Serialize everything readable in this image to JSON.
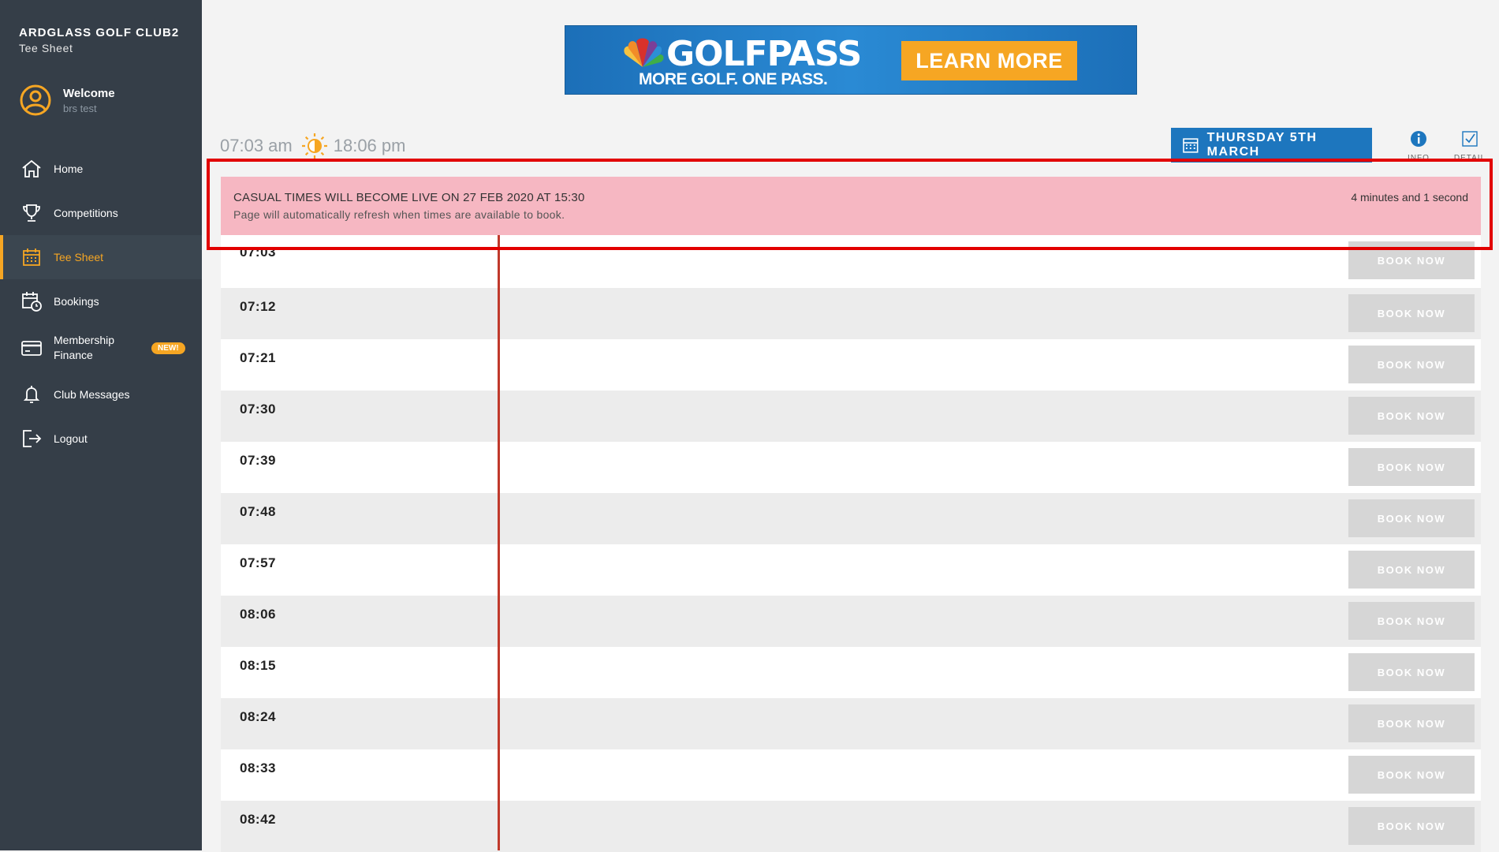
{
  "sidebar": {
    "club_name": "ARDGLASS GOLF CLUB2",
    "subtitle": "Tee Sheet",
    "welcome": "Welcome",
    "user": "brs test",
    "items": [
      {
        "label": "Home",
        "icon": "home-icon",
        "active": false
      },
      {
        "label": "Competitions",
        "icon": "trophy-icon",
        "active": false
      },
      {
        "label": "Tee Sheet",
        "icon": "calendar-grid-icon",
        "active": true
      },
      {
        "label": "Bookings",
        "icon": "calendar-clock-icon",
        "active": false
      },
      {
        "label": "Membership Finance",
        "line1": "Membership",
        "line2": "Finance",
        "icon": "credit-card-icon",
        "badge": "NEW!",
        "active": false
      },
      {
        "label": "Club Messages",
        "icon": "bell-icon",
        "active": false
      },
      {
        "label": "Logout",
        "icon": "logout-icon",
        "active": false
      }
    ]
  },
  "ad": {
    "brand": "GOLFPASS",
    "tagline": "MORE GOLF. ONE PASS.",
    "cta": "LEARN MORE"
  },
  "sun": {
    "sunrise": "07:03 am",
    "sunset": "18:06 pm"
  },
  "toolbar": {
    "date_label": "THURSDAY 5TH MARCH",
    "info_label": "INFO",
    "detail_label": "DETAIL"
  },
  "alert": {
    "title": "CASUAL TIMES WILL BECOME LIVE ON 27 FEB 2020 AT 15:30",
    "subtitle": "Page will automatically refresh when times are available to book.",
    "countdown": "4 minutes and 1 second"
  },
  "tee_times": [
    {
      "time": "07:03",
      "action": "BOOK NOW"
    },
    {
      "time": "07:12",
      "action": "BOOK NOW"
    },
    {
      "time": "07:21",
      "action": "BOOK NOW"
    },
    {
      "time": "07:30",
      "action": "BOOK NOW"
    },
    {
      "time": "07:39",
      "action": "BOOK NOW"
    },
    {
      "time": "07:48",
      "action": "BOOK NOW"
    },
    {
      "time": "07:57",
      "action": "BOOK NOW"
    },
    {
      "time": "08:06",
      "action": "BOOK NOW"
    },
    {
      "time": "08:15",
      "action": "BOOK NOW"
    },
    {
      "time": "08:24",
      "action": "BOOK NOW"
    },
    {
      "time": "08:33",
      "action": "BOOK NOW"
    },
    {
      "time": "08:42",
      "action": "BOOK NOW"
    }
  ],
  "colors": {
    "sidebar_bg": "#353e48",
    "accent": "#f6a623",
    "date_button": "#1d76be",
    "alert_bg": "#f6b7c2",
    "highlight_outline": "#e20000",
    "timeline": "#c0392b",
    "book_button_disabled": "#d6d6d6"
  }
}
